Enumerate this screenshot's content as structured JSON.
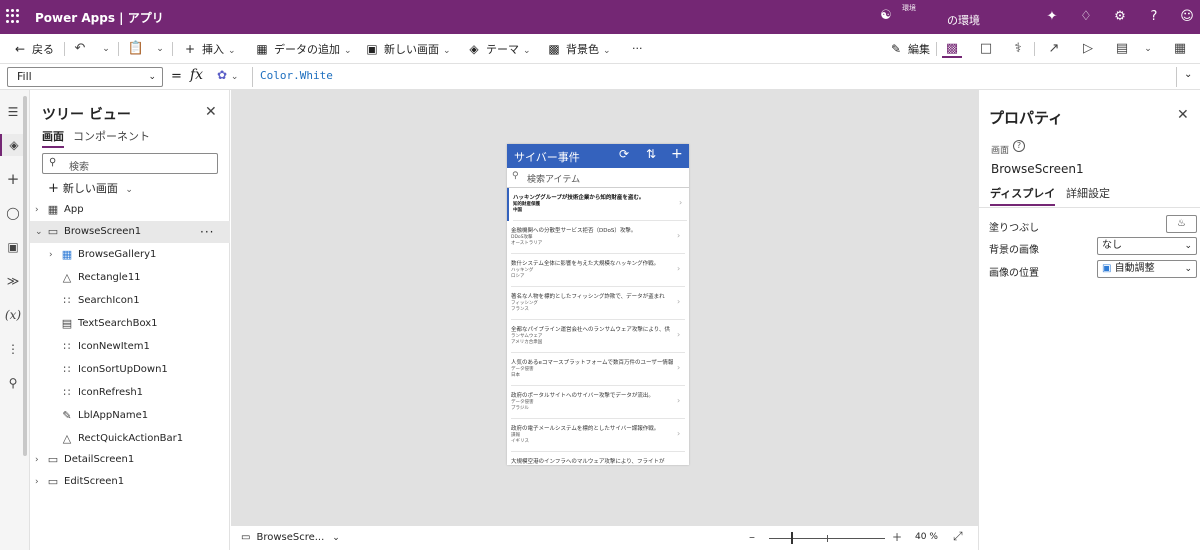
{
  "app": {
    "product": "Power Apps",
    "separator": "|",
    "title": "アプリ",
    "environment_label": "環境",
    "environment_name": "の環境"
  },
  "commandbar": {
    "back": "戻る",
    "insert": "挿入",
    "add_data": "データの追加",
    "new_screen": "新しい画面",
    "theme": "テーマ",
    "background": "背景色",
    "more": "···",
    "edit": "編集"
  },
  "formula": {
    "property": "Fill",
    "equals": "=",
    "fx": "fx",
    "value": "Color.White"
  },
  "tree": {
    "title": "ツリー ビュー",
    "tab_screens": "画面",
    "tab_components": "コンポーネント",
    "search_placeholder": "検索",
    "new_screen": "新しい画面",
    "items": [
      {
        "label": "App"
      },
      {
        "label": "BrowseScreen1"
      },
      {
        "label": "BrowseGallery1"
      },
      {
        "label": "Rectangle11"
      },
      {
        "label": "SearchIcon1"
      },
      {
        "label": "TextSearchBox1"
      },
      {
        "label": "IconNewItem1"
      },
      {
        "label": "IconSortUpDown1"
      },
      {
        "label": "IconRefresh1"
      },
      {
        "label": "LblAppName1"
      },
      {
        "label": "RectQuickActionBar1"
      },
      {
        "label": "DetailScreen1"
      },
      {
        "label": "EditScreen1"
      }
    ],
    "more": "···"
  },
  "canvas": {
    "app_title": "サイバー事件",
    "search_placeholder": "検索アイテム",
    "gallery": [
      {
        "title": "ハッキンググループが技術企業から知的財産を盗む。",
        "sub1": "知的財産保護",
        "sub2": "中国"
      },
      {
        "title": "金融機関への分散型サービス拒否（DDoS）攻撃。",
        "sub1": "DDoS攻撃",
        "sub2": "オーストラリア"
      },
      {
        "title": "数什システム全体に影響を与えた大規模なハッキング作戦。",
        "sub1": "ハッキング",
        "sub2": "ロシア"
      },
      {
        "title": "著名な人物を標的としたフィッシング詐欺で、データが盗まれ",
        "sub1": "フィッシング",
        "sub2": "フランス"
      },
      {
        "title": "全都なパイプライン運営会社へのランサムウェア攻撃により、供",
        "sub1": "ランサムウェア",
        "sub2": "アメリカ合衆国"
      },
      {
        "title": "人気のあるeコマースプラットフォームで数百万件のユーザー情報",
        "sub1": "データ侵害",
        "sub2": "日本"
      },
      {
        "title": "政府のポータルサイトへのサイバー攻撃でデータが流出。",
        "sub1": "データ侵害",
        "sub2": "ブラジル"
      },
      {
        "title": "政府の電子メールシステムを標的としたサイバー諜報作戦。",
        "sub1": "諜報",
        "sub2": "イギリス"
      },
      {
        "title": "大規模空港のインフラへのマルウェア攻撃により、フライトが",
        "sub1": "",
        "sub2": ""
      }
    ]
  },
  "statusbar": {
    "screen": "BrowseScre...",
    "zoom": "40 %",
    "zoom_fraction": 0.4
  },
  "properties": {
    "title": "プロパティ",
    "type_label": "画面",
    "help": "?",
    "control_name": "BrowseScreen1",
    "tab_display": "ディスプレイ",
    "tab_advanced": "詳細設定",
    "fill_label": "塗りつぶし",
    "bg_image_label": "背景の画像",
    "bg_image_value": "なし",
    "image_pos_label": "画像の位置",
    "image_pos_value": "自動調整"
  },
  "colors": {
    "brand": "#742774",
    "app_header": "#3462bd"
  }
}
